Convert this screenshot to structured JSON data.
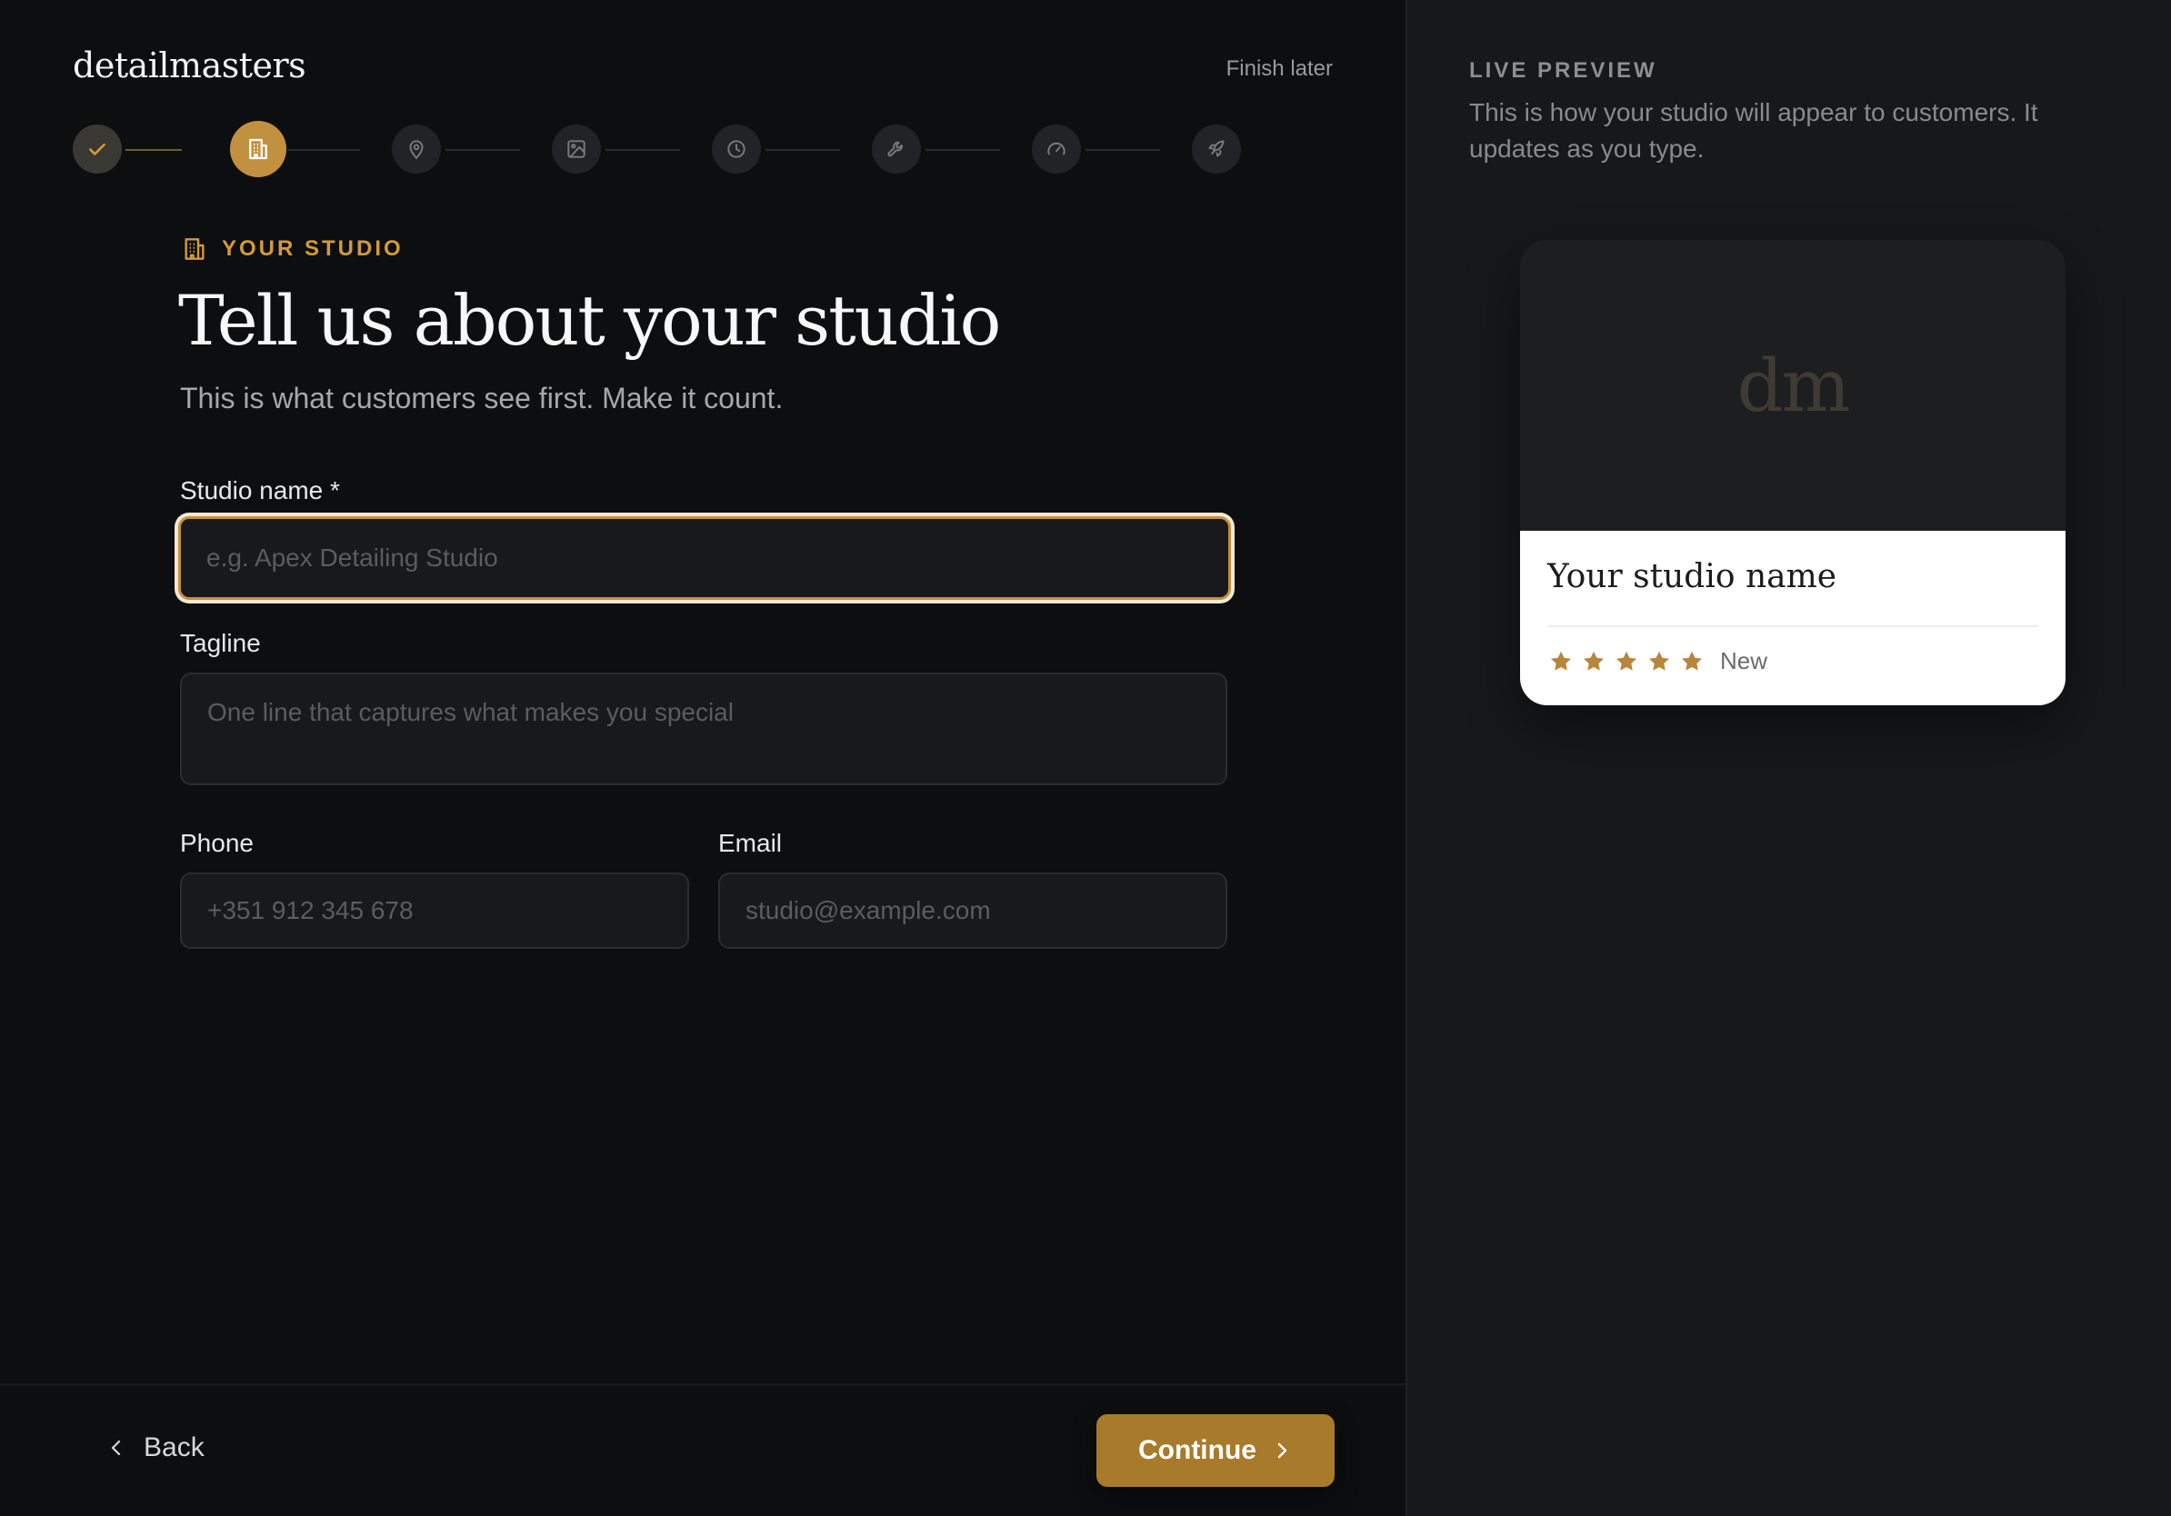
{
  "brand": "detailmasters",
  "header": {
    "finish_later": "Finish later"
  },
  "stepper": {
    "current_index": 1,
    "steps": [
      {
        "icon": "check-icon",
        "state": "done"
      },
      {
        "icon": "building-icon",
        "state": "active"
      },
      {
        "icon": "map-pin-icon",
        "state": "pending"
      },
      {
        "icon": "image-icon",
        "state": "pending"
      },
      {
        "icon": "clock-icon",
        "state": "pending"
      },
      {
        "icon": "wrench-icon",
        "state": "pending"
      },
      {
        "icon": "gauge-icon",
        "state": "pending"
      },
      {
        "icon": "rocket-icon",
        "state": "pending"
      }
    ]
  },
  "section": {
    "tag": "YOUR STUDIO",
    "title": "Tell us about your studio",
    "subtitle": "This is what customers see first. Make it count."
  },
  "form": {
    "studio_name": {
      "label": "Studio name *",
      "value": "",
      "placeholder": "e.g. Apex Detailing Studio"
    },
    "tagline": {
      "label": "Tagline",
      "value": "",
      "placeholder": "One line that captures what makes you special"
    },
    "phone": {
      "label": "Phone",
      "value": "",
      "placeholder": "+351 912 345 678"
    },
    "email": {
      "label": "Email",
      "value": "",
      "placeholder": "studio@example.com"
    }
  },
  "footer": {
    "back_label": "Back",
    "continue_label": "Continue"
  },
  "preview": {
    "tag": "LIVE PREVIEW",
    "description": "This is how your studio will appear to customers. It updates as you type.",
    "card": {
      "monogram": "dm",
      "name": "Your studio name",
      "rating_stars": 5,
      "rating_label": "New"
    }
  },
  "colors": {
    "accent": "#c2913f",
    "button": "#a87a2b",
    "background": "#0d0e10",
    "panel": "#17181a"
  }
}
